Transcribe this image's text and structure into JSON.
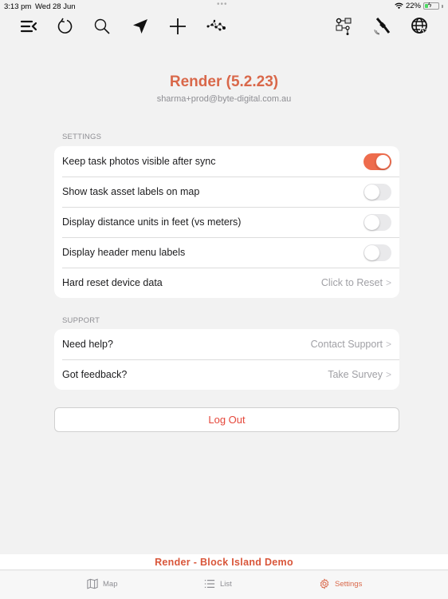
{
  "status_bar": {
    "time": "3:13 pm",
    "date": "Wed 28 Jun",
    "multitask_dots": "•••",
    "battery_percent": "22%",
    "battery_level": 0.22,
    "charging": true
  },
  "toolbar": {
    "left_icons": [
      "collapse-menu-icon",
      "refresh-icon",
      "search-icon",
      "navigation-arrow-icon",
      "add-icon",
      "network-nodes-icon"
    ],
    "right_icons": [
      "workflow-diagram-icon",
      "satellite-icon",
      "globe-cursor-icon"
    ]
  },
  "header": {
    "title": "Render (5.2.23)",
    "email": "sharma+prod@byte-digital.com.au"
  },
  "settings": {
    "section_label": "SETTINGS",
    "rows": [
      {
        "label": "Keep task photos visible after sync",
        "type": "toggle",
        "on": true
      },
      {
        "label": "Show task asset labels on map",
        "type": "toggle",
        "on": false
      },
      {
        "label": "Display distance units in feet (vs meters)",
        "type": "toggle",
        "on": false
      },
      {
        "label": "Display header menu labels",
        "type": "toggle",
        "on": false
      },
      {
        "label": "Hard reset device data",
        "type": "link",
        "detail": "Click to Reset"
      }
    ]
  },
  "support": {
    "section_label": "SUPPORT",
    "rows": [
      {
        "label": "Need help?",
        "detail": "Contact Support"
      },
      {
        "label": "Got feedback?",
        "detail": "Take Survey"
      }
    ]
  },
  "logout_label": "Log Out",
  "footer_banner": "Render - Block Island Demo",
  "tabs": [
    {
      "label": "Map",
      "icon": "map-icon",
      "active": false
    },
    {
      "label": "List",
      "icon": "list-icon",
      "active": false
    },
    {
      "label": "Settings",
      "icon": "gear-icon",
      "active": true
    }
  ],
  "colors": {
    "accent": "#d9684a",
    "toggle_on": "#ee6c4d",
    "logout": "#e5473a"
  }
}
